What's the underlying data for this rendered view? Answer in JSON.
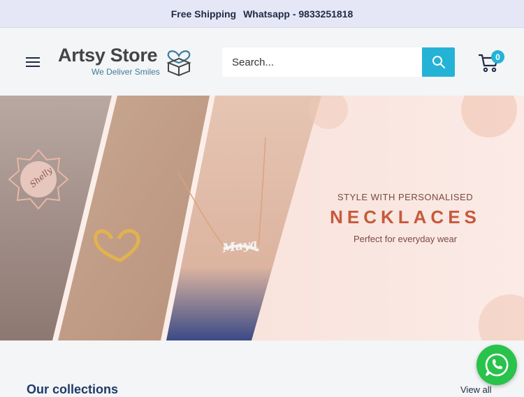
{
  "topbar": {
    "shipping": "Free Shipping",
    "whatsapp": "Whatsapp - 9833251818"
  },
  "header": {
    "logo_name": "Artsy Store",
    "logo_tagline": "We Deliver Smiles",
    "search_placeholder": "Search...",
    "cart_count": "0"
  },
  "hero": {
    "eyebrow": "STYLE WITH PERSONALISED",
    "title": "NECKLACES",
    "subtitle": "Perfect for everyday wear",
    "pendant_names": [
      "Shelly",
      "Maya"
    ]
  },
  "section": {
    "title": "Our collections",
    "view_all": "View all"
  },
  "colors": {
    "accent": "#24b3d6",
    "brand_text": "#1f3a6a",
    "hero_title": "#c65a3b",
    "whatsapp": "#29c24b",
    "topbar_bg": "#e6e7f6"
  },
  "icons": [
    "menu-icon",
    "search-icon",
    "cart-icon",
    "whatsapp-icon",
    "gift-box-heart-icon"
  ]
}
